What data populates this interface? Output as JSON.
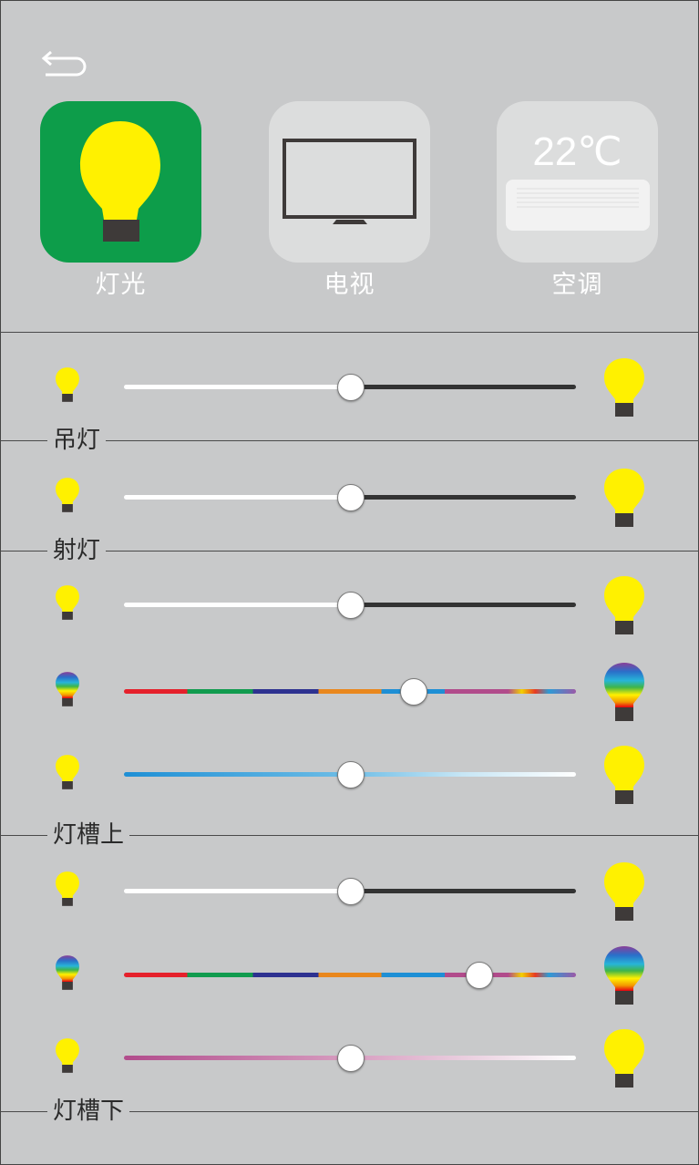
{
  "devices": [
    {
      "label": "灯光",
      "icon": "bulb-icon",
      "selected": true,
      "color": "#0d9d4a"
    },
    {
      "label": "电视",
      "icon": "tv-icon",
      "selected": false,
      "color": "#dcdddd"
    },
    {
      "label": "空调",
      "icon": "ac-icon",
      "selected": false,
      "color": "#dcdddd",
      "temperature": "22℃"
    }
  ],
  "colors": {
    "background": "#c8c9ca",
    "bulb_yellow": "#fff100",
    "bulb_base": "#3e3a39",
    "selected_tile": "#0d9d4a",
    "track_dark": "#333333",
    "track_light": "#ffffff"
  },
  "sections": [
    {
      "name": "吊灯",
      "sliders": [
        {
          "type": "brightness",
          "value": 0.5
        }
      ]
    },
    {
      "name": "射灯",
      "sliders": [
        {
          "type": "brightness",
          "value": 0.5
        }
      ]
    },
    {
      "name": "灯槽上",
      "sliders": [
        {
          "type": "brightness",
          "value": 0.5
        },
        {
          "type": "color",
          "value": 0.64
        },
        {
          "type": "color-temperature-blue",
          "value": 0.5
        }
      ]
    },
    {
      "name": "灯槽下",
      "sliders": [
        {
          "type": "brightness",
          "value": 0.5
        },
        {
          "type": "color",
          "value": 0.785
        },
        {
          "type": "color-temperature-pink",
          "value": 0.5
        }
      ]
    }
  ]
}
